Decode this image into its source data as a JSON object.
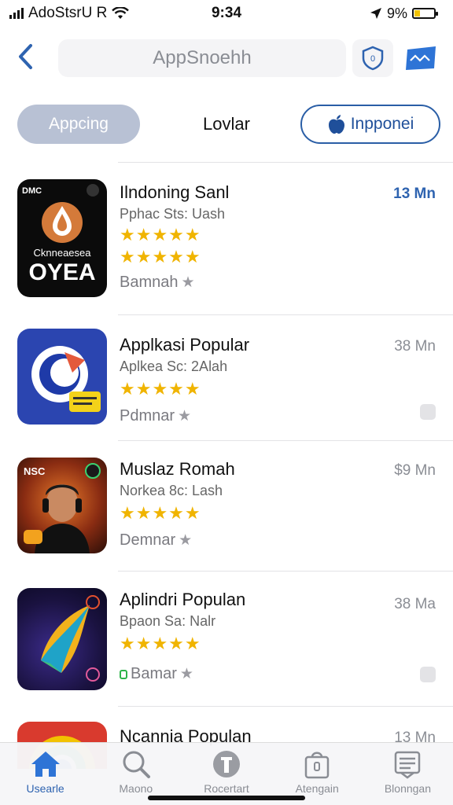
{
  "status_bar": {
    "carrier": "AdoStsrU R",
    "time": "9:34",
    "battery_percent": "9%",
    "battery_level": 0.3
  },
  "nav": {
    "title": "AppSnoehh",
    "back_icon": "chevron-left-icon",
    "shield_icon": "shield-icon",
    "mail_icon": "mail-icon",
    "accent": "#2e63b0"
  },
  "segments": {
    "left": "Appcing",
    "center": "Lovlar",
    "right": "Inpponei"
  },
  "apps": [
    {
      "name": "Ilndoning Sanl",
      "subtitle": "Pphac Sts: Uash",
      "stars": "★★★★★",
      "stars2": "★★★★★",
      "action": "Bamnah",
      "size": "13 Mn",
      "icon_top_left": "DMC",
      "icon_text_small": "Cknneaesea",
      "icon_text_big": "OYEA"
    },
    {
      "name": "Applkasi Popular",
      "subtitle": "Aplkea Sc: 2Alah",
      "stars": "★★★★★",
      "action": "Pdmnar",
      "size": "38 Mn"
    },
    {
      "name": "Muslaz Romah",
      "subtitle": "Norkea 8c: Lash",
      "stars": "★★★★★",
      "action": "Demnar",
      "size": "$9 Mn",
      "icon_top_left": "NSC"
    },
    {
      "name": "Aplindri Populan",
      "subtitle": "Bpaon Sa: Nalr",
      "stars": "★★★★★",
      "action": "Bamar",
      "size": "38 Ma"
    },
    {
      "name": "Ncannia Populan",
      "size": "13 Mn"
    }
  ],
  "tabs": [
    {
      "label": "Usearle",
      "icon": "home-icon"
    },
    {
      "label": "Maono",
      "icon": "search-icon"
    },
    {
      "label": "Rocertart",
      "icon": "info-icon"
    },
    {
      "label": "Atengain",
      "icon": "bag-icon"
    },
    {
      "label": "Blonngan",
      "icon": "list-icon"
    }
  ]
}
